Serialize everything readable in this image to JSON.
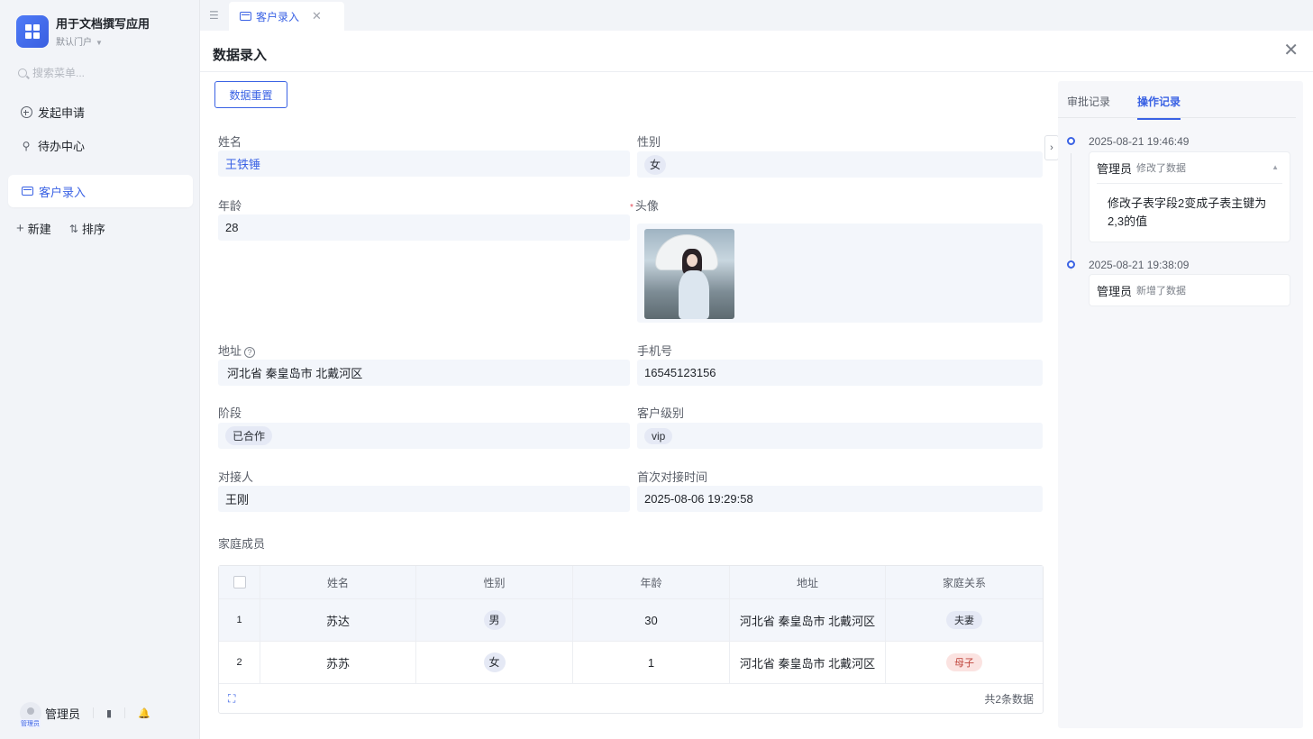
{
  "app": {
    "title": "用于文档撰写应用",
    "portal": "默认门户"
  },
  "sidebar": {
    "search_placeholder": "搜索菜单...",
    "items": [
      {
        "label": "发起申请"
      },
      {
        "label": "待办中心"
      },
      {
        "label": "客户录入"
      }
    ],
    "new_label": "新建",
    "sort_label": "排序",
    "user": {
      "name": "管理员",
      "tag": "管理员"
    }
  },
  "tabs": [
    {
      "label": "客户录入"
    }
  ],
  "panel": {
    "title": "数据录入",
    "reset_label": "数据重置"
  },
  "form": {
    "name": {
      "label": "姓名",
      "value": "王铁锤"
    },
    "gender": {
      "label": "性别",
      "value": "女"
    },
    "age": {
      "label": "年龄",
      "value": "28"
    },
    "avatar": {
      "label": "头像",
      "required": "*"
    },
    "address": {
      "label": "地址",
      "value": "河北省 秦皇岛市 北戴河区"
    },
    "phone": {
      "label": "手机号",
      "value": "16545123156"
    },
    "stage": {
      "label": "阶段",
      "value": "已合作"
    },
    "level": {
      "label": "客户级别",
      "value": "vip"
    },
    "contact": {
      "label": "对接人",
      "value": "王刚"
    },
    "first_time": {
      "label": "首次对接时间",
      "value": "2025-08-06 19:29:58"
    },
    "family_label": "家庭成员"
  },
  "table": {
    "columns": [
      "姓名",
      "性别",
      "年龄",
      "地址",
      "家庭关系"
    ],
    "rows": [
      {
        "idx": "1",
        "name": "苏达",
        "gender": "男",
        "age": "30",
        "address": "河北省 秦皇岛市 北戴河区",
        "relation": "夫妻"
      },
      {
        "idx": "2",
        "name": "苏苏",
        "gender": "女",
        "age": "1",
        "address": "河北省 秦皇岛市 北戴河区",
        "relation": "母子"
      }
    ],
    "total": "共2条数据"
  },
  "records": {
    "tabs": [
      "审批记录",
      "操作记录"
    ],
    "items": [
      {
        "time": "2025-08-21 19:46:49",
        "user": "管理员",
        "action": "修改了数据",
        "detail": "修改子表字段2变成子表主键为2,3的值"
      },
      {
        "time": "2025-08-21 19:38:09",
        "user": "管理员",
        "action": "新增了数据"
      }
    ]
  },
  "colors": {
    "accent": "#3a62e4",
    "field_bg": "#f3f6fb",
    "danger": "#e34d59"
  }
}
